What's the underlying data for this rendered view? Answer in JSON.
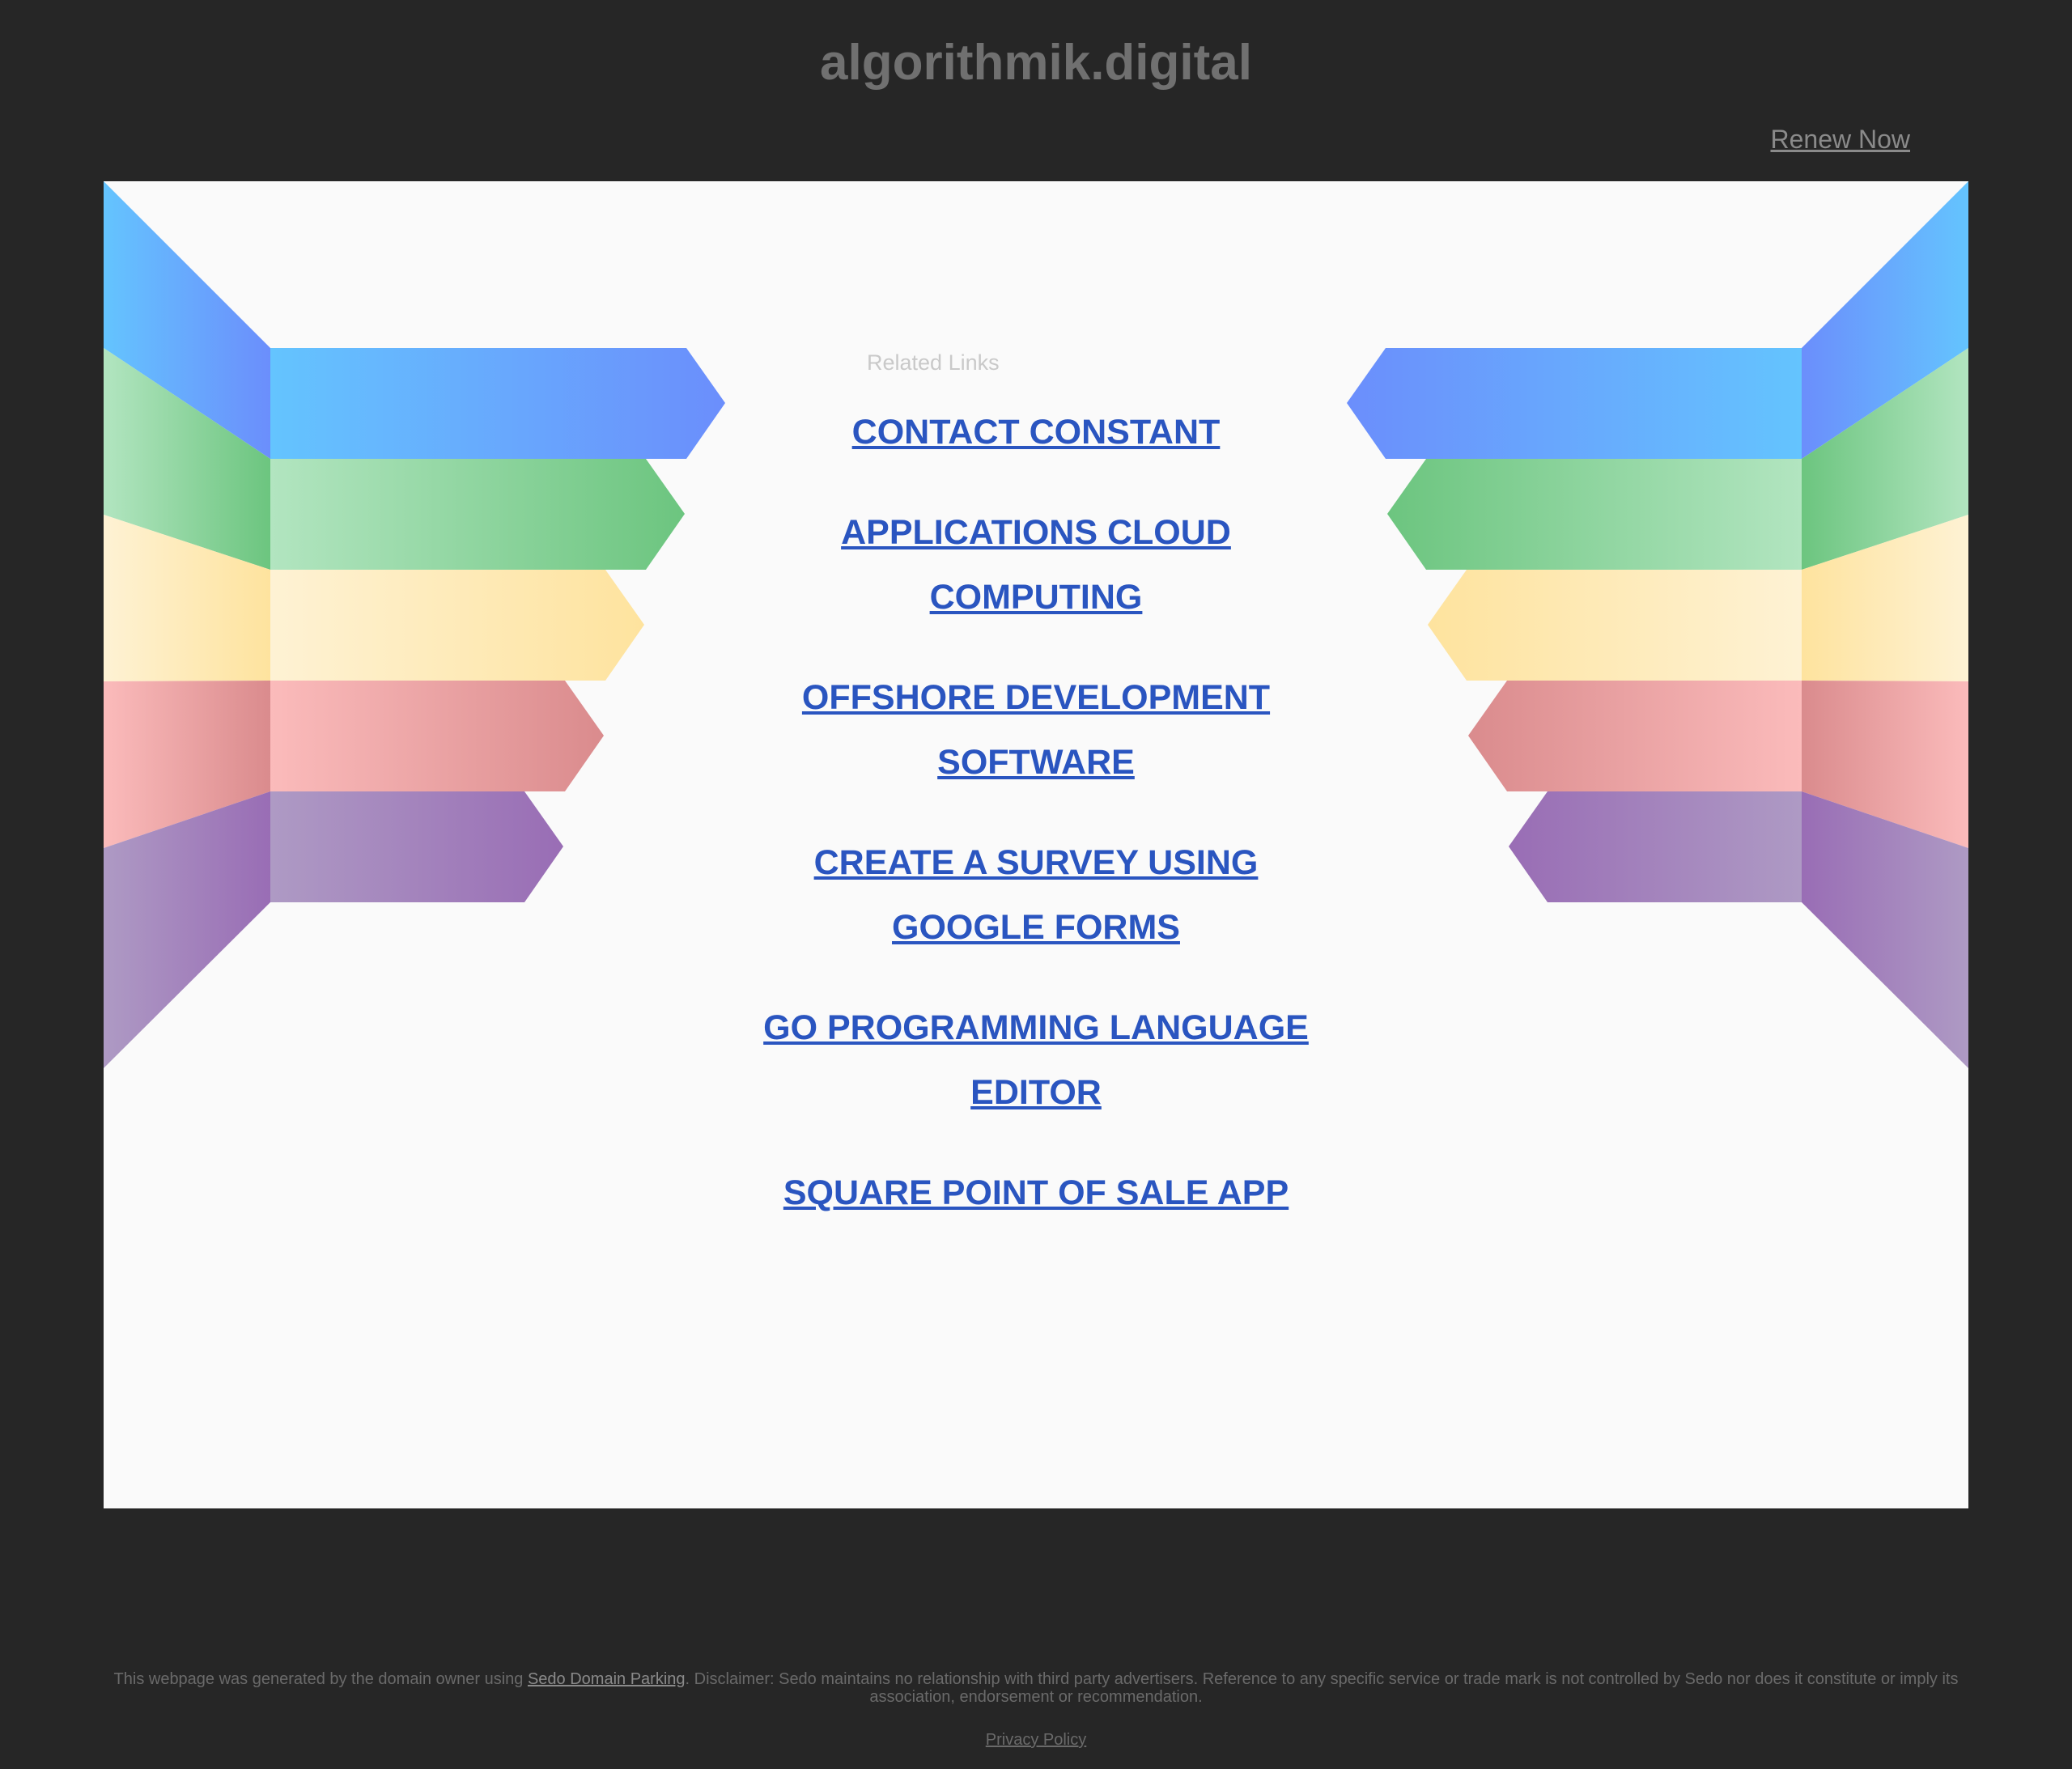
{
  "header": {
    "domain_title": "algorithmik.digital",
    "renew_label": "Renew Now"
  },
  "related": {
    "heading": "Related Links",
    "links": [
      "CONTACT CONSTANT",
      "APPLICATIONS CLOUD COMPUTING",
      "OFFSHORE DEVELOPMENT SOFTWARE",
      "CREATE A SURVEY USING GOOGLE FORMS",
      "GO PROGRAMMING LANGUAGE EDITOR",
      "SQUARE POINT OF SALE APP"
    ]
  },
  "footer": {
    "disclaimer_prefix": "This webpage was generated by the domain owner using ",
    "sedo_link": "Sedo Domain Parking",
    "disclaimer_suffix": ". Disclaimer: Sedo maintains no relationship with third party advertisers. Reference to any specific service or trade mark is not controlled by Sedo nor does it constitute or imply its association, endorsement or recommendation.",
    "privacy_label": "Privacy Policy"
  },
  "colors": {
    "background": "#262626",
    "panel": "#fafafa",
    "link": "#2a55c0",
    "ribbon_blue": "#64c4fe",
    "ribbon_indigo": "#6b8efc",
    "ribbon_green": "#6cc57f",
    "ribbon_light_green": "#b2e5c0",
    "ribbon_yellow": "#fee39e",
    "ribbon_cream": "#fef2d4",
    "ribbon_red": "#da8b8d",
    "ribbon_pink": "#fbbbbb",
    "ribbon_purple": "#996db5",
    "ribbon_lavender": "#ae9ac4"
  }
}
